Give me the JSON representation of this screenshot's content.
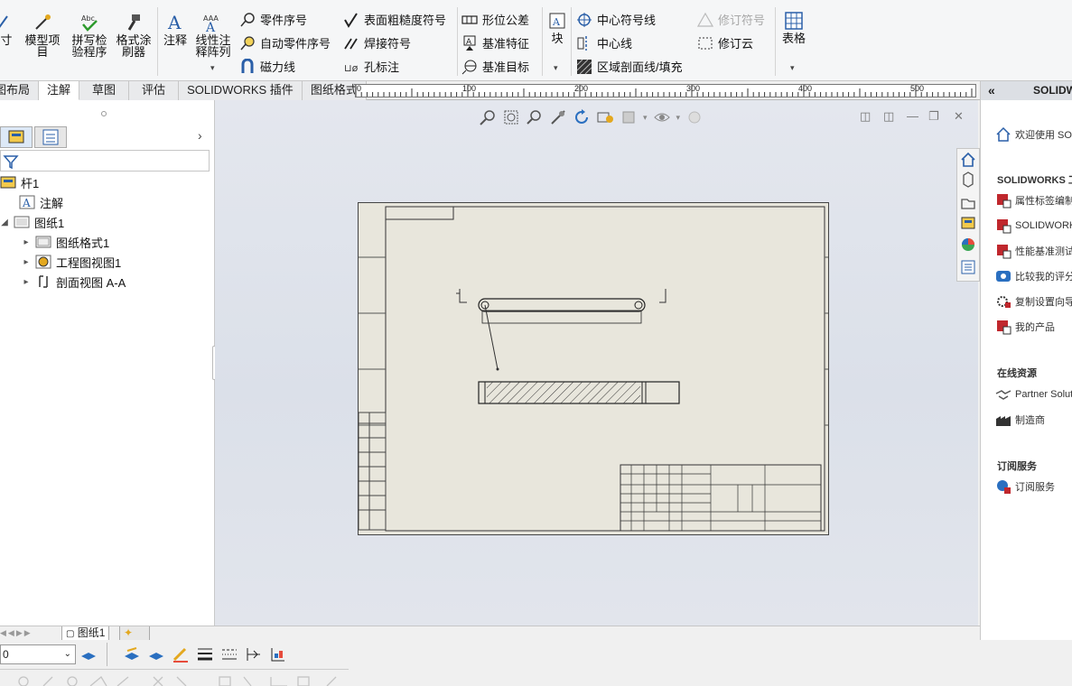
{
  "ribbon": {
    "partial_left": "寸",
    "model_items": "模型项目",
    "spell_check": "拼写检验程序",
    "format_painter": "格式涂刷器",
    "annotation": "注释",
    "linear_note_pattern": "线性注释阵列",
    "balloon": "零件序号",
    "auto_balloon": "自动零件序号",
    "magnetic_line": "磁力线",
    "surface_finish": "表面粗糙度符号",
    "weld_symbol": "焊接符号",
    "hole_callout": "孔标注",
    "geometric_tolerance": "形位公差",
    "datum_feature": "基准特征",
    "datum_target": "基准目标",
    "block": "块",
    "center_mark": "中心符号线",
    "centerline": "中心线",
    "area_hatch": "区域剖面线/填充",
    "revision_symbol": "修订符号",
    "revision_cloud": "修订云",
    "table": "表格"
  },
  "tabs": [
    {
      "label": "图布局",
      "active": false
    },
    {
      "label": "注解",
      "active": true
    },
    {
      "label": "草图",
      "active": false
    },
    {
      "label": "评估",
      "active": false
    },
    {
      "label": "SOLIDWORKS 插件",
      "active": false
    },
    {
      "label": "图纸格式",
      "active": false
    }
  ],
  "ruler": {
    "labels": [
      "0",
      "100",
      "200",
      "300",
      "400",
      "500"
    ]
  },
  "tree": {
    "items": [
      {
        "label": "杆1"
      },
      {
        "label": "注解"
      },
      {
        "label": "图纸1"
      },
      {
        "label": "图纸格式1"
      },
      {
        "label": "工程图视图1"
      },
      {
        "label": "剖面视图 A-A"
      }
    ]
  },
  "sheet_tabs": {
    "active": "图纸1"
  },
  "layer": {
    "value": "0"
  },
  "taskpane": {
    "header": "SOLIDWORKS",
    "welcome": "欢迎使用 SOLIDWORKS",
    "tools_title": "SOLIDWORKS 工具",
    "tools": [
      "属性标签编制程序",
      "SOLIDWORKS Rx",
      "性能基准测试",
      "比较我的评分",
      "复制设置向导",
      "我的产品"
    ],
    "online_title": "在线资源",
    "online": [
      "Partner Solutions",
      "制造商"
    ],
    "subscription_title": "订阅服务",
    "subscription": [
      "订阅服务"
    ]
  },
  "colors": {
    "accent": "#1f6fbf",
    "sheet": "#e8e6dc",
    "hatch": "#333333",
    "rx_red": "#c0272d"
  }
}
